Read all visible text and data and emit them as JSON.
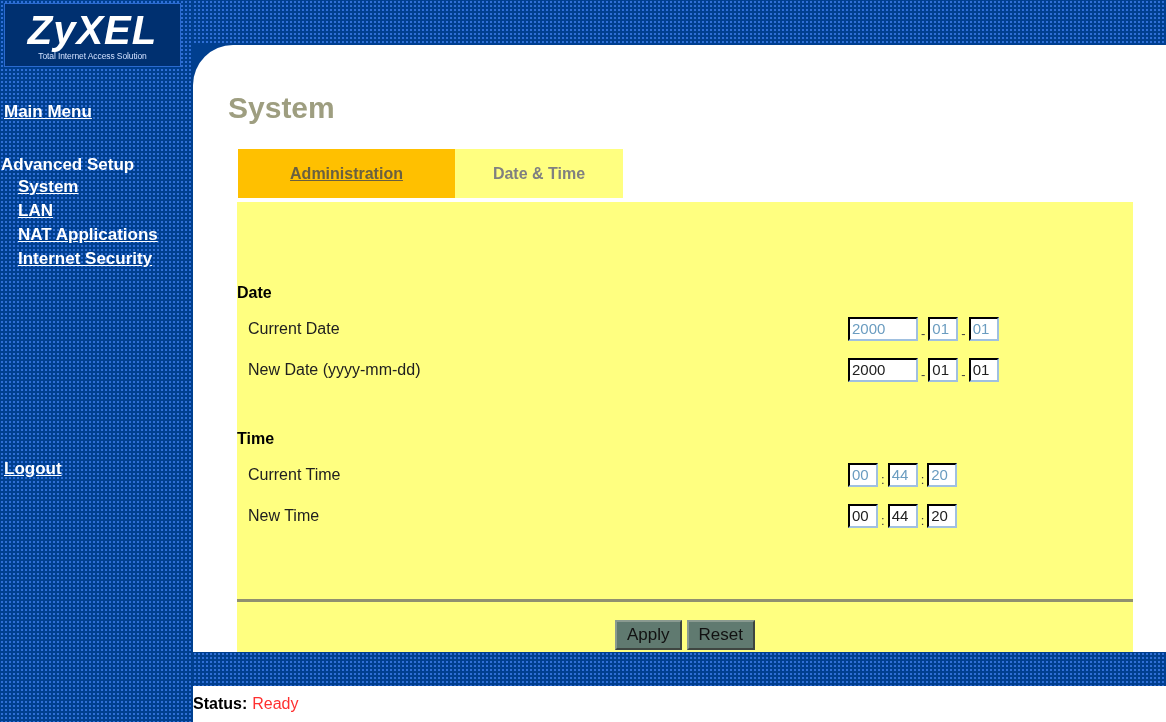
{
  "logo": {
    "name": "ZyXEL",
    "tagline": "Total Internet Access Solution"
  },
  "sidebar": {
    "items": [
      {
        "kind": "link",
        "label": "Main Menu"
      },
      {
        "kind": "group",
        "label": "Advanced Setup",
        "children": [
          {
            "label": "System"
          },
          {
            "label": "LAN"
          },
          {
            "label": "NAT Applications"
          },
          {
            "label": "Internet Security"
          }
        ]
      },
      {
        "kind": "link",
        "label": "Logout"
      }
    ]
  },
  "page_title": "System",
  "tabs": [
    {
      "label": "Administration",
      "selected": false
    },
    {
      "label": "Date & Time",
      "selected": true
    }
  ],
  "sections": [
    {
      "heading": "Date",
      "separator": "-",
      "rows": [
        {
          "label": "Current Date",
          "fields": [
            {
              "value": "2000",
              "disabled": true
            },
            {
              "value": "01",
              "disabled": true
            },
            {
              "value": "01",
              "disabled": true
            }
          ]
        },
        {
          "label": "New Date (yyyy-mm-dd)",
          "fields": [
            {
              "value": "2000",
              "disabled": false
            },
            {
              "value": "01",
              "disabled": false
            },
            {
              "value": "01",
              "disabled": false
            }
          ]
        }
      ]
    },
    {
      "heading": "Time",
      "separator": ":",
      "rows": [
        {
          "label": "Current Time",
          "fields": [
            {
              "value": "00",
              "disabled": true
            },
            {
              "value": "44",
              "disabled": true
            },
            {
              "value": "20",
              "disabled": true
            }
          ]
        },
        {
          "label": "New Time",
          "fields": [
            {
              "value": "00",
              "disabled": false
            },
            {
              "value": "44",
              "disabled": false
            },
            {
              "value": "20",
              "disabled": false
            }
          ]
        }
      ]
    }
  ],
  "buttons": [
    "Apply",
    "Reset"
  ],
  "status": {
    "label": "Status:",
    "value": "Ready"
  }
}
